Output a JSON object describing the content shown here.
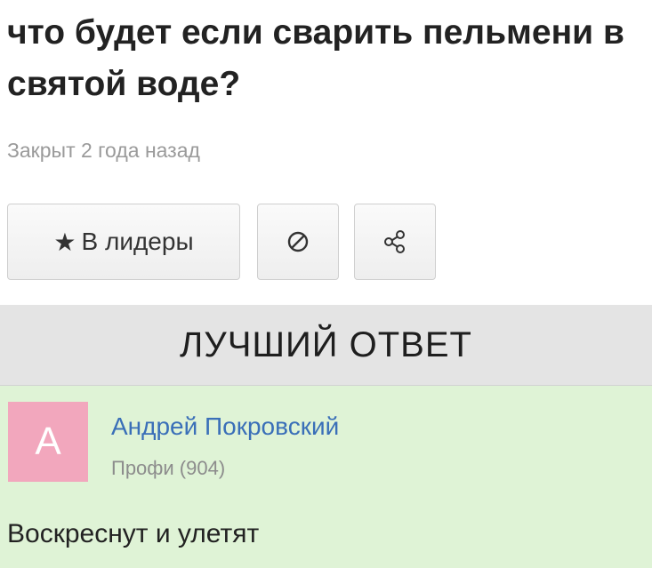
{
  "question": {
    "title": "что будет если сварить пельмени в святой воде?",
    "meta": "Закрыт 2 года назад"
  },
  "actions": {
    "leaders_icon": "star-icon",
    "leaders_label": "В лидеры",
    "block_icon": "block-icon",
    "share_icon": "share-icon"
  },
  "best_answer": {
    "header": "ЛУЧШИЙ ОТВЕТ",
    "avatar_letter": "A",
    "author_name": "Андрей Покровский",
    "author_rank": "Профи (904)",
    "text": "Воскреснут и улетят"
  },
  "colors": {
    "header_bg": "#e4e4e4",
    "answer_bg": "#dff3d6",
    "avatar_bg": "#f2a7bd",
    "author_link": "#3a6fb8",
    "meta_text": "#9a9a9a"
  }
}
